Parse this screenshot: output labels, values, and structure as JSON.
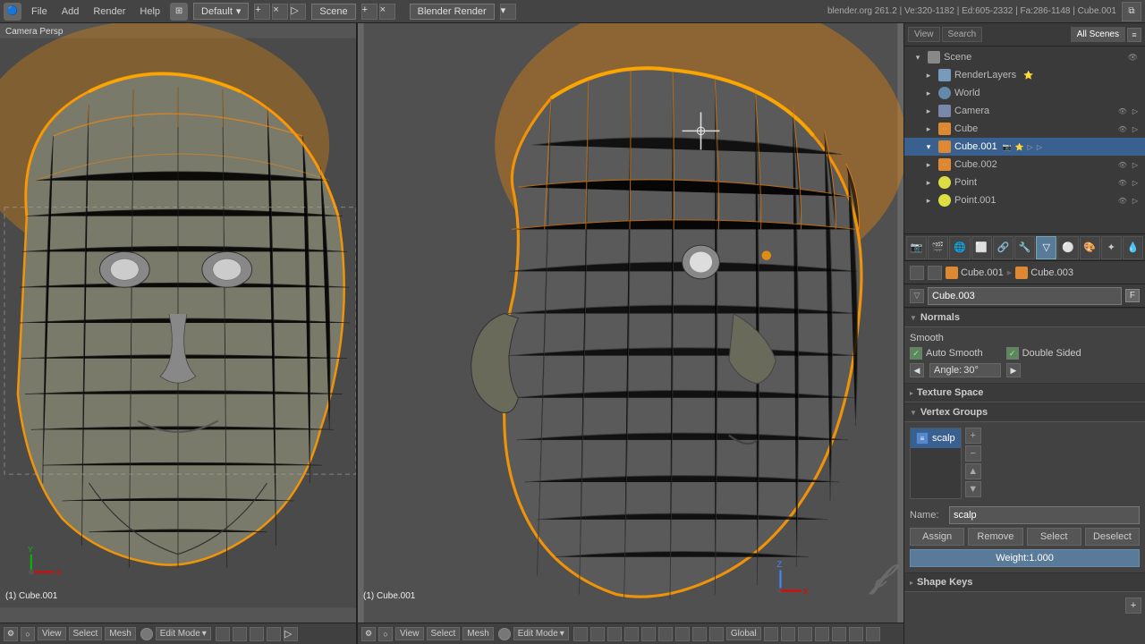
{
  "topbar": {
    "engine": "Blender Render",
    "info": "blender.org 261.2 | Ve:320-1182 | Ed:605-2332 | Fa:286-1148 | Cube.001",
    "layout": "Default",
    "scene": "Scene",
    "menus": [
      "File",
      "Add",
      "Render",
      "Help"
    ]
  },
  "scene_tree": {
    "header_tabs": [
      "View",
      "Search",
      "All Scenes"
    ],
    "items": [
      {
        "label": "Scene",
        "icon": "scene",
        "level": 0
      },
      {
        "label": "RenderLayers",
        "icon": "render",
        "level": 1
      },
      {
        "label": "World",
        "icon": "world",
        "level": 1
      },
      {
        "label": "Camera",
        "icon": "camera",
        "level": 1
      },
      {
        "label": "Cube",
        "icon": "mesh",
        "level": 1
      },
      {
        "label": "Cube.001",
        "icon": "mesh",
        "level": 1,
        "selected": true
      },
      {
        "label": "Cube.002",
        "icon": "mesh",
        "level": 1
      },
      {
        "label": "Point",
        "icon": "light",
        "level": 1
      },
      {
        "label": "Point.001",
        "icon": "light",
        "level": 1
      }
    ]
  },
  "breadcrumb": {
    "parent": "Cube.001",
    "child": "Cube.003"
  },
  "object_name": "Cube.003",
  "normals": {
    "section_label": "Normals",
    "auto_smooth": "Auto Smooth",
    "auto_smooth_checked": true,
    "double_sided": "Double Sided",
    "double_sided_checked": true,
    "smooth_label": "Smooth",
    "angle_label": "Angle:",
    "angle_value": "30°"
  },
  "texture_space": {
    "section_label": "Texture Space"
  },
  "vertex_groups": {
    "section_label": "Vertex Groups",
    "groups": [
      {
        "label": "scalp",
        "selected": true
      }
    ],
    "side_buttons": [
      "+",
      "-",
      "▲",
      "▼"
    ],
    "name_label": "Name:",
    "name_value": "scalp",
    "buttons": [
      "Assign",
      "Remove",
      "Select",
      "Deselect"
    ],
    "weight_label": "Weight:",
    "weight_value": "1.000"
  },
  "shape_keys": {
    "section_label": "Shape Keys"
  },
  "viewport_left": {
    "label": "Camera Persp",
    "bottom_label": "(1) Cube.001"
  },
  "viewport_right": {
    "bottom_label": "(1) Cube.001"
  },
  "bottom_bar_left": {
    "view": "View",
    "select": "Select",
    "mesh": "Mesh",
    "mode": "Edit Mode"
  },
  "bottom_bar_right": {
    "view": "View",
    "select": "Select",
    "mesh": "Mesh",
    "mode": "Edit Mode",
    "orientation": "Global"
  }
}
